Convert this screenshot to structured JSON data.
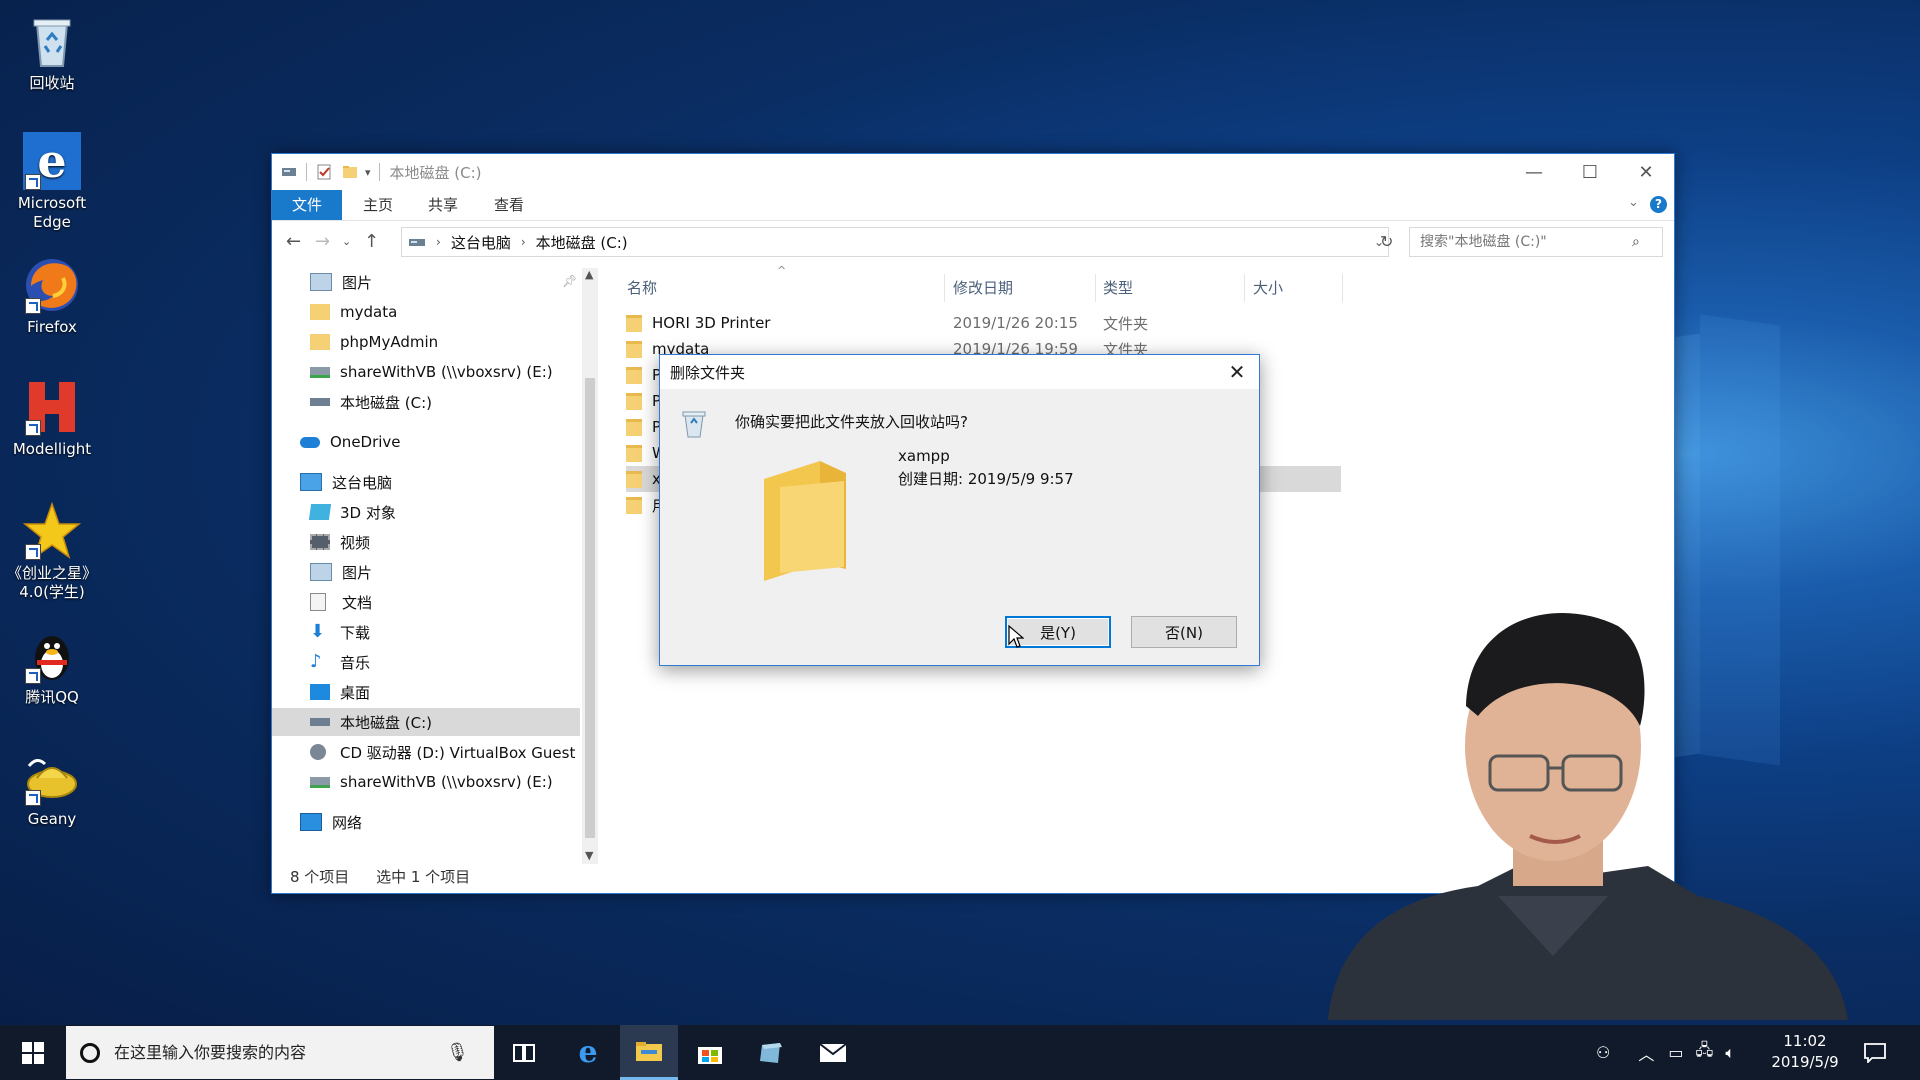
{
  "desktop": {
    "icons": [
      {
        "label": "回收站"
      },
      {
        "label": "Microsoft Edge"
      },
      {
        "label": "Firefox"
      },
      {
        "label": "Modellight"
      },
      {
        "label": "《创业之星》4.0(学生)"
      },
      {
        "label": "腾讯QQ"
      },
      {
        "label": "Geany"
      }
    ]
  },
  "explorer": {
    "title": "本地磁盘 (C:)",
    "ribbon_tabs": [
      "文件",
      "主页",
      "共享",
      "查看"
    ],
    "breadcrumb": [
      "这台电脑",
      "本地磁盘 (C:)"
    ],
    "search_placeholder": "搜索\"本地磁盘 (C:)\"",
    "nav_items": [
      {
        "label": "图片"
      },
      {
        "label": "mydata"
      },
      {
        "label": "phpMyAdmin"
      },
      {
        "label": "shareWithVB (\\\\vboxsrv) (E:)"
      },
      {
        "label": "本地磁盘 (C:)"
      },
      {
        "label": "OneDrive"
      },
      {
        "label": "这台电脑"
      },
      {
        "label": "3D 对象"
      },
      {
        "label": "视频"
      },
      {
        "label": "图片"
      },
      {
        "label": "文档"
      },
      {
        "label": "下载"
      },
      {
        "label": "音乐"
      },
      {
        "label": "桌面"
      },
      {
        "label": "本地磁盘 (C:)"
      },
      {
        "label": "CD 驱动器 (D:) VirtualBox Guest A"
      },
      {
        "label": "shareWithVB (\\\\vboxsrv) (E:)"
      },
      {
        "label": "网络"
      }
    ],
    "columns": [
      "名称",
      "修改日期",
      "类型",
      "大小"
    ],
    "files": [
      {
        "name": "HORI 3D Printer",
        "date": "2019/1/26 20:15",
        "type": "文件夹"
      },
      {
        "name": "mydata",
        "date": "2019/1/26 19:59",
        "type": "文件夹"
      },
      {
        "name": "P"
      },
      {
        "name": "P"
      },
      {
        "name": "P"
      },
      {
        "name": "W"
      },
      {
        "name": "x"
      },
      {
        "name": "用"
      }
    ],
    "status": {
      "count": "8 个项目",
      "selected": "选中 1 个项目"
    }
  },
  "dialog": {
    "title": "删除文件夹",
    "question": "你确实要把此文件夹放入回收站吗?",
    "item_name": "xampp",
    "item_created": "创建日期: 2019/5/9 9:57",
    "yes_label": "是(Y)",
    "no_label": "否(N)"
  },
  "taskbar": {
    "search_placeholder": "在这里输入你要搜索的内容",
    "time": "11:02",
    "date": "2019/5/9"
  },
  "colors": {
    "accent": "#1979ca",
    "folder": "#f6d074",
    "taskbar": "#101a2a"
  }
}
